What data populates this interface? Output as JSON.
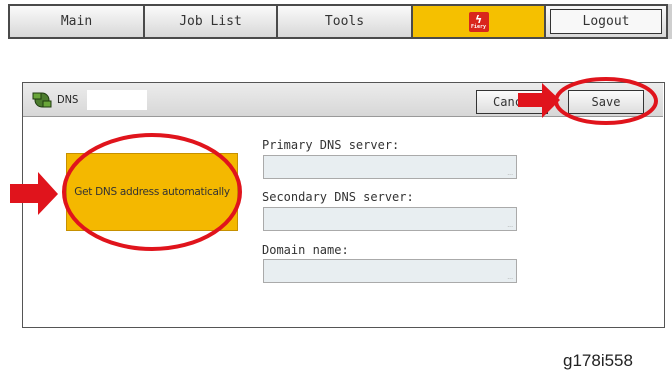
{
  "tabs": {
    "main": "Main",
    "job_list": "Job List",
    "tools": "Tools",
    "fiery_logo_text": "Fiery",
    "logout": "Logout"
  },
  "dialog": {
    "title": "DNS",
    "cancel_label": "Canc",
    "save_label": "Save",
    "auto_button_label": "Get DNS address automatically",
    "primary_label": "Primary DNS server:",
    "primary_value": "",
    "secondary_label": "Secondary DNS server:",
    "secondary_value": "",
    "domain_label": "Domain name:",
    "domain_value": ""
  },
  "figure_caption": "g178i558",
  "colors": {
    "accent_yellow": "#f4b800",
    "annotation_red": "#e0141c",
    "fiery_red": "#d9261c"
  }
}
